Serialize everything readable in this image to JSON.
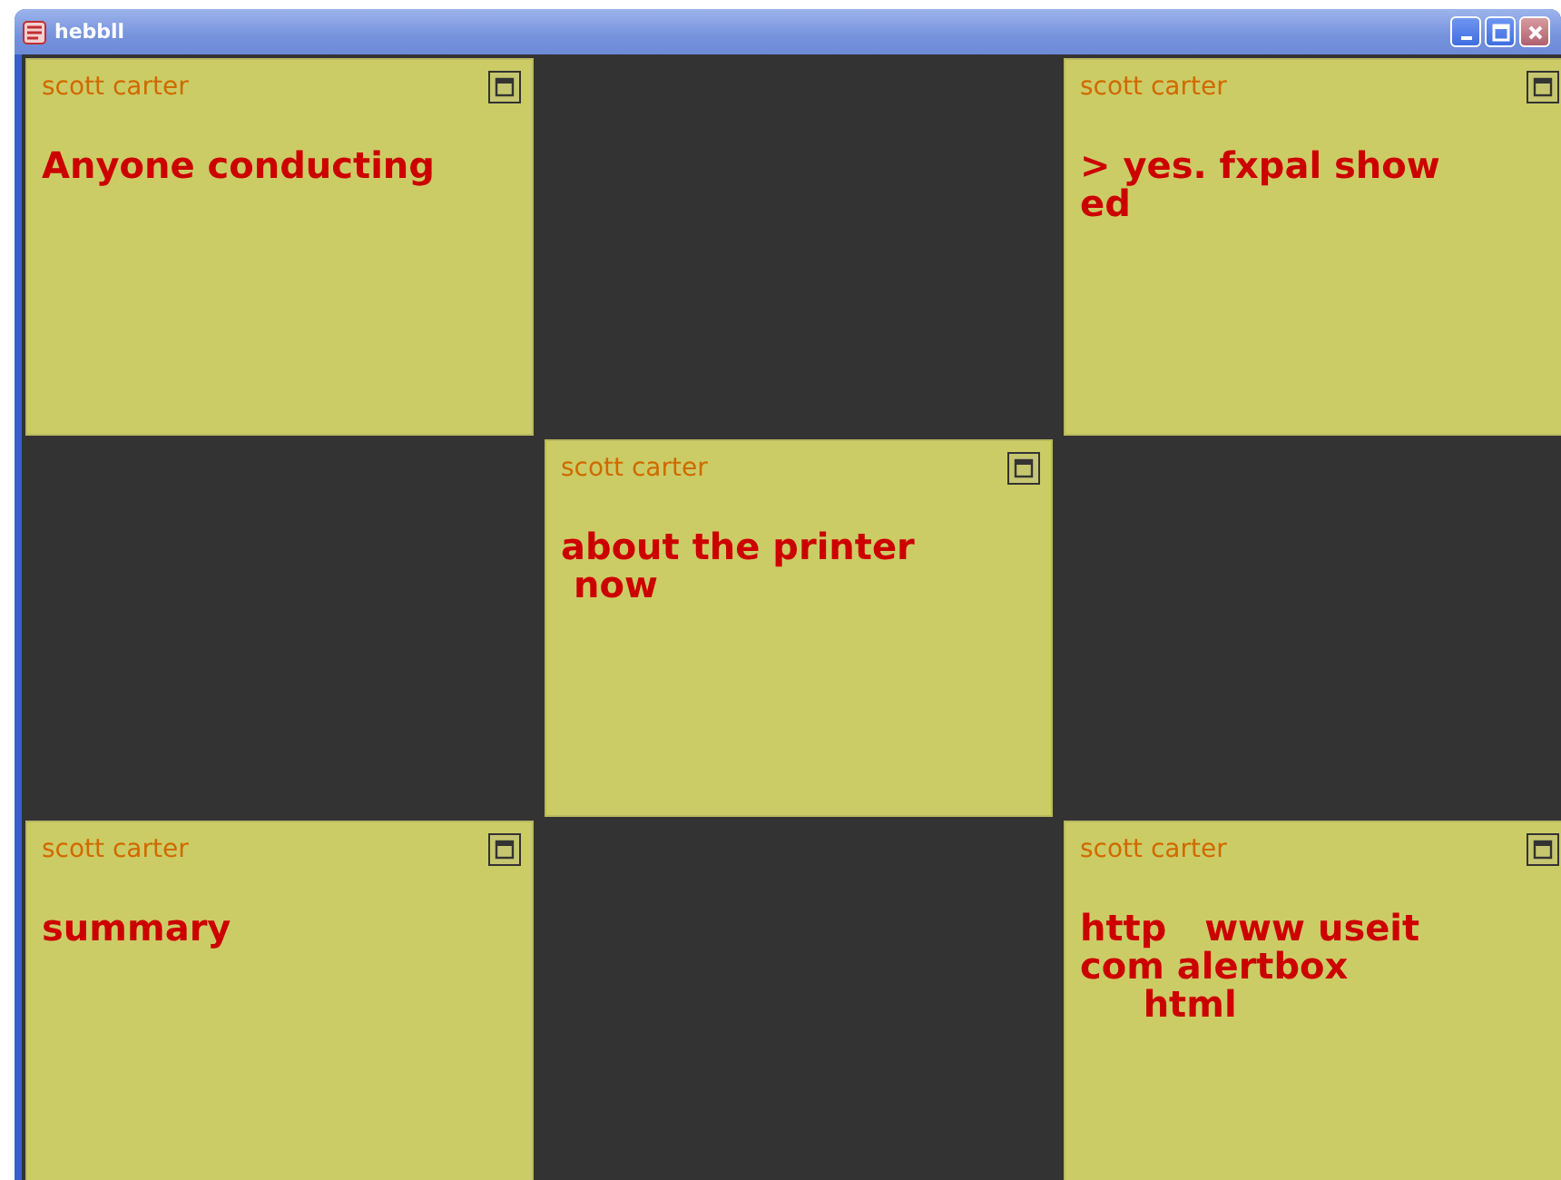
{
  "window": {
    "title": "hebbll"
  },
  "cells": [
    {
      "kind": "note",
      "author": "scott carter",
      "text": "Anyone conducting"
    },
    {
      "kind": "empty"
    },
    {
      "kind": "note",
      "author": "scott carter",
      "text": "> yes. fxpal show\ned"
    },
    {
      "kind": "empty"
    },
    {
      "kind": "note",
      "author": "scott carter",
      "text": "about the printer\n now"
    },
    {
      "kind": "empty"
    },
    {
      "kind": "note",
      "author": "scott carter",
      "text": "summary"
    },
    {
      "kind": "empty"
    },
    {
      "kind": "note",
      "author": "scott carter",
      "text": "http   www useit\ncom alertbox\n     html"
    }
  ]
}
